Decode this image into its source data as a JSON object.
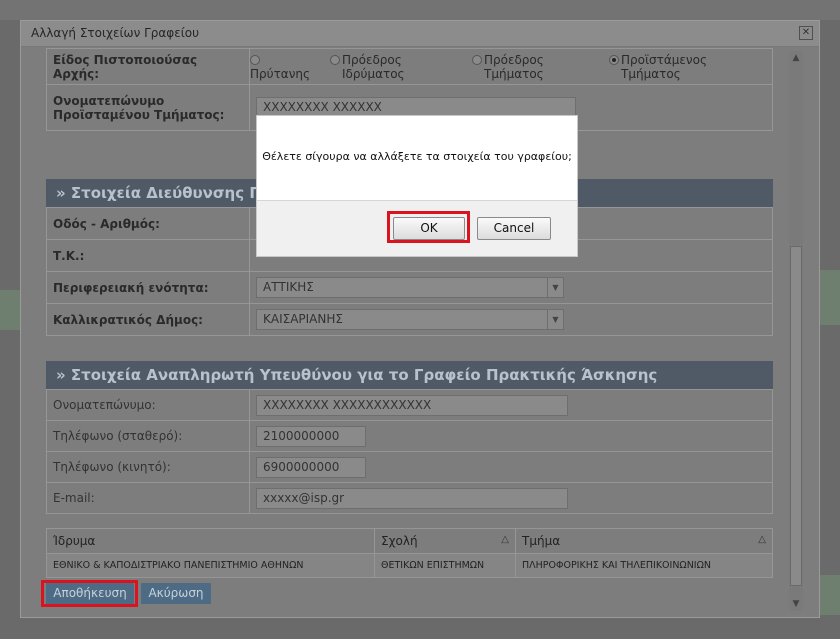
{
  "dialog": {
    "title": "Αλλαγή Στοιχείων Γραφείου",
    "close_glyph": "✕"
  },
  "authority": {
    "label": "Είδος Πιστοποιούσας Αρχής:",
    "options": [
      {
        "label": "Πρύτανης",
        "selected": false
      },
      {
        "label": "Πρόεδρος Ιδρύματος",
        "selected": false
      },
      {
        "label": "Πρόεδρος Τμήματος",
        "selected": false
      },
      {
        "label": "Προϊστάμενος Τμήματος",
        "selected": true
      }
    ]
  },
  "head_name": {
    "label": "Ονοματεπώνυμο Προϊσταμένου Τμήματος:",
    "value": "XXXXXXXX XXXXXX"
  },
  "address_section": {
    "title": "» Στοιχεία Διεύθυνσης Γρ",
    "street_label": "Οδός - Αριθμός:",
    "postal_label": "Τ.Κ.:",
    "region_label": "Περιφερειακή ενότητα:",
    "region_value": "ΑΤΤΙΚΗΣ",
    "municipality_label": "Καλλικρατικός Δήμος:",
    "municipality_value": "ΚΑΙΣΑΡΙΑΝΗΣ"
  },
  "deputy_section": {
    "title": "» Στοιχεία Αναπληρωτή Υπευθύνου για το Γραφείο Πρακτικής Άσκησης",
    "name_label": "Ονοματεπώνυμο:",
    "name_value": "XXXXXXXX XXXXXXXXXXXX",
    "phone_label": "Τηλέφωνο (σταθερό):",
    "phone_value": "2100000000",
    "mobile_label": "Τηλέφωνο (κινητό):",
    "mobile_value": "6900000000",
    "email_label": "E-mail:",
    "email_value": "xxxxx@isp.gr"
  },
  "institution_grid": {
    "columns": [
      "Ίδρυμα",
      "Σχολή",
      "Τμήμα"
    ],
    "rows": [
      [
        "ΕΘΝΙΚΟ & ΚΑΠΟΔΙΣΤΡΙΑΚΟ ΠΑΝΕΠΙΣΤΗΜΙΟ ΑΘΗΝΩΝ",
        "ΘΕΤΙΚΩΝ ΕΠΙΣΤΗΜΩΝ",
        "ΠΛΗΡΟΦΟΡΙΚΗΣ ΚΑΙ ΤΗΛΕΠΙΚΟΙΝΩΝΙΩΝ"
      ]
    ],
    "sort_glyph": "△"
  },
  "actions": {
    "save_label": "Αποθήκευση",
    "cancel_label": "Ακύρωση"
  },
  "confirm": {
    "message": "Θέλετε σίγουρα να αλλάξετε τα στοιχεία του γραφείου;",
    "ok_label": "OK",
    "cancel_label": "Cancel"
  },
  "colors": {
    "highlight": "#d9141e",
    "section_header": "#4f5a66",
    "button": "#4d6b85"
  }
}
